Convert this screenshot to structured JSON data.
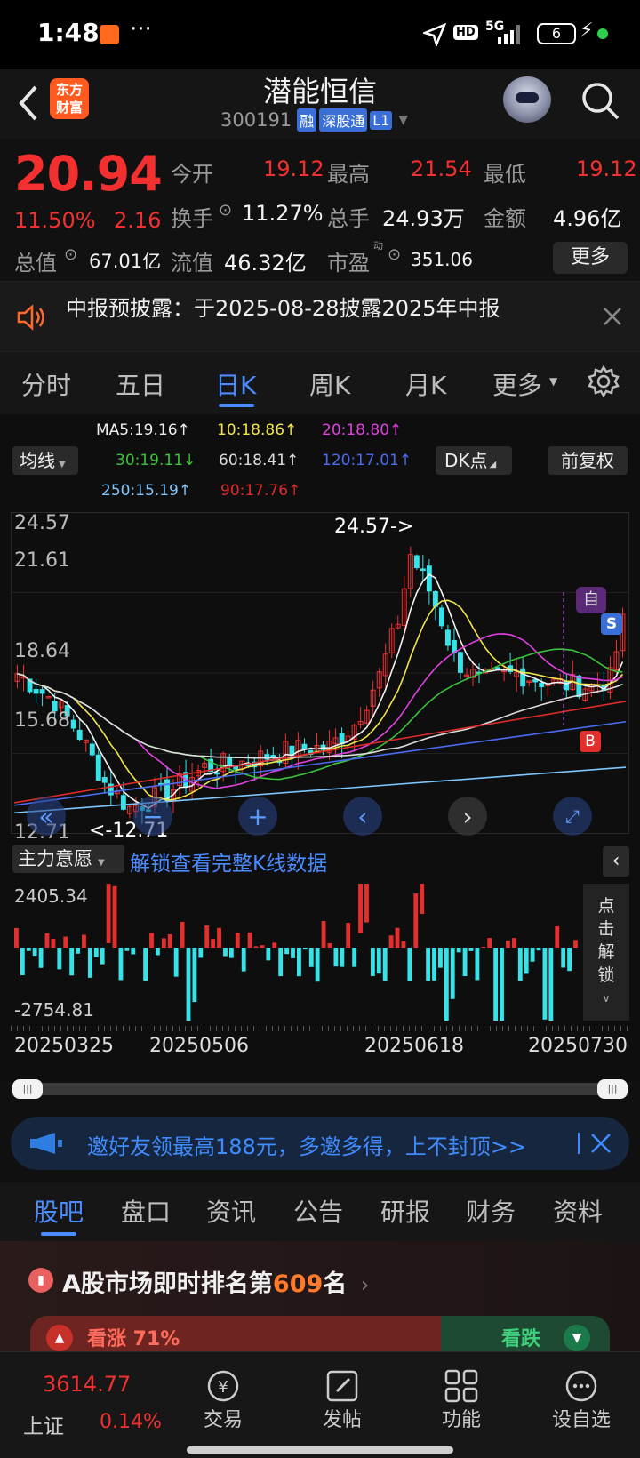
{
  "status": {
    "time": "1:48",
    "dots": "···",
    "battery": "6",
    "network": "5G"
  },
  "header": {
    "logo_line1": "东方",
    "logo_line2": "财富",
    "stock_name": "潜能恒信",
    "code": "300191",
    "tag_margin": "融",
    "tag_connect": "深股通",
    "tag_level": "L1"
  },
  "quote": {
    "price": "20.94",
    "change_pct": "11.50%",
    "change": "2.16",
    "open_label": "今开",
    "open": "19.12",
    "high_label": "最高",
    "high": "21.54",
    "low_label": "最低",
    "low": "19.12",
    "turnover_label": "换手",
    "turnover": "11.27%",
    "volume_label": "总手",
    "volume": "24.93万",
    "amount_label": "金额",
    "amount": "4.96亿",
    "mktcap_label": "总值",
    "mktcap": "67.01亿",
    "float_label": "流值",
    "float": "46.32亿",
    "pe_label": "市盈",
    "pe_sup": "动",
    "pe": "351.06",
    "more_button": "更多"
  },
  "notice": {
    "text": "中报预披露：于2025-08-28披露2025年中报"
  },
  "period_tabs": [
    "分时",
    "五日",
    "日K",
    "周K",
    "月K",
    "更多"
  ],
  "active_tab": "日K",
  "ma": {
    "selector": "均线",
    "ma5": "MA5:19.16↑",
    "ma10": "10:18.86↑",
    "ma20": "20:18.80↑",
    "ma30": "30:19.11↓",
    "ma60": "60:18.41↑",
    "ma120": "120:17.01↑",
    "ma250": "250:15.19↑",
    "ma90": "90:17.76↑",
    "dk_button": "DK点",
    "adjust_button": "前复权"
  },
  "kline": {
    "y_labels": [
      "24.57",
      "21.61",
      "18.64",
      "15.68",
      "12.71"
    ],
    "max_note": "24.57->",
    "min_note": "<-12.71",
    "tag_self": "自",
    "tag_sell": "S",
    "tag_buy": "B"
  },
  "indicator": {
    "selector": "主力意愿",
    "unlock_link": "解锁查看完整K线数据",
    "y_top": "2405.34",
    "y_bottom": "-2754.81",
    "side_unlock": [
      "点",
      "击",
      "解",
      "锁"
    ]
  },
  "dates": [
    "20250325",
    "20250506",
    "20250618",
    "20250730"
  ],
  "banner": {
    "text": "邀好友领最高188元，多邀多得，上不封顶>>"
  },
  "section_tabs": [
    "股吧",
    "盘口",
    "资讯",
    "公告",
    "研报",
    "财务",
    "资料"
  ],
  "active_section": "股吧",
  "ranking": {
    "prefix": "A股市场即时排名第",
    "rank": "609",
    "suffix": "名"
  },
  "vote": {
    "up": "看涨 71%",
    "down": "看跌"
  },
  "bottom_nav": {
    "index_value": "3614.77",
    "index_name": "上证",
    "index_change": "0.14%",
    "items": [
      "交易",
      "发帖",
      "功能",
      "设自选"
    ]
  },
  "colors": {
    "up": "#f2302f",
    "down": "#36e3e8",
    "accent": "#4a8bff",
    "brand": "#ff5a1f"
  }
}
